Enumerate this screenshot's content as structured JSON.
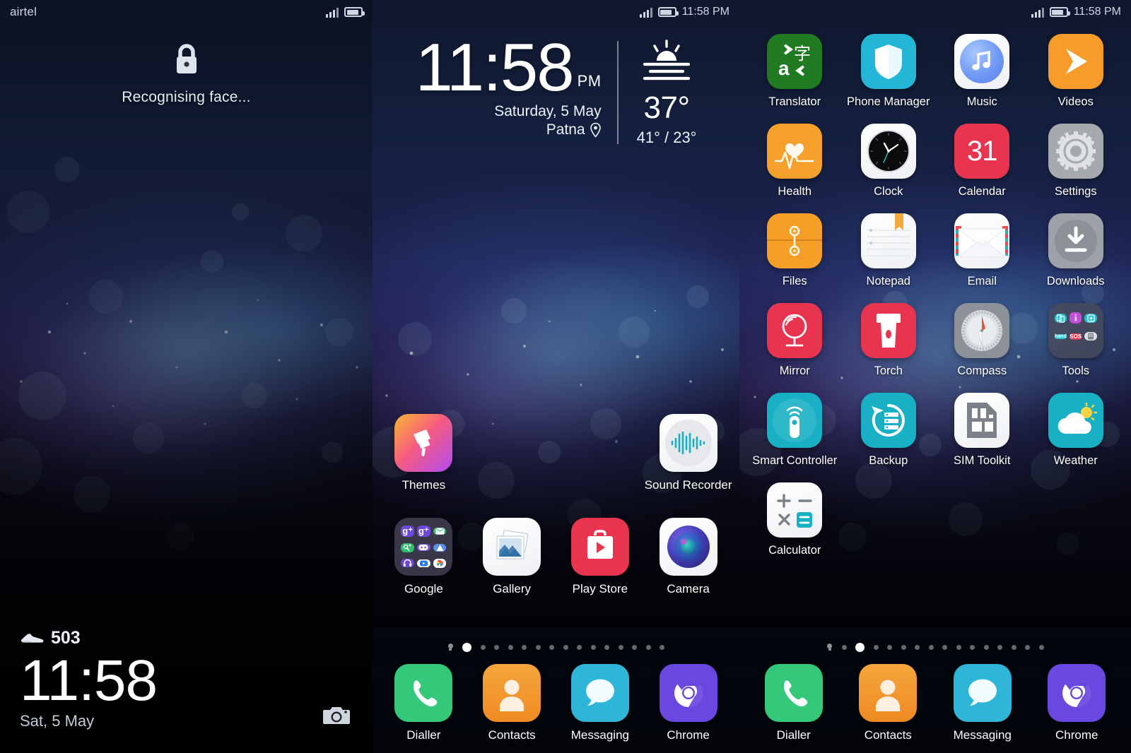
{
  "screens": [
    {
      "id": "lock-screen",
      "statusbar": {
        "carrier": "airtel",
        "time": "",
        "signal_icon": "signal-bars-icon",
        "battery_icon": "battery-icon"
      },
      "lock": {
        "lock_icon": "lock-icon",
        "message": "Recognising face...",
        "steps_icon": "shoe-icon",
        "steps": "503",
        "time": "11:58",
        "date": "Sat, 5 May",
        "shutter_icon": "camera-shutter-icon"
      }
    },
    {
      "id": "home-screen",
      "statusbar": {
        "carrier": "",
        "time": "11:58 PM",
        "signal_icon": "signal-bars-icon",
        "battery_icon": "battery-icon"
      },
      "widget": {
        "time": "11:58",
        "ampm": "PM",
        "date": "Saturday, 5 May",
        "location": "Patna",
        "location_icon": "location-pin-icon",
        "weather_icon": "haze-sun-icon",
        "temp": "37°",
        "range": "41° / 23°"
      },
      "apps": [
        {
          "label": "Themes",
          "icon": "themes-icon"
        },
        {
          "label": "",
          "icon": ""
        },
        {
          "label": "",
          "icon": ""
        },
        {
          "label": "Sound Recorder",
          "icon": "sound-recorder-icon"
        },
        {
          "label": "Google",
          "icon": "google-folder-icon"
        },
        {
          "label": "Gallery",
          "icon": "gallery-icon"
        },
        {
          "label": "Play Store",
          "icon": "play-store-icon"
        },
        {
          "label": "Camera",
          "icon": "camera-icon"
        }
      ],
      "page_dots": {
        "total": 16,
        "active_index": 1,
        "home_index": 0
      },
      "dock": [
        {
          "label": "Dialler",
          "icon": "phone-icon"
        },
        {
          "label": "Contacts",
          "icon": "contacts-icon"
        },
        {
          "label": "Messaging",
          "icon": "messaging-icon"
        },
        {
          "label": "Chrome",
          "icon": "chrome-icon"
        }
      ]
    },
    {
      "id": "app-drawer-screen",
      "statusbar": {
        "carrier": "",
        "time": "11:58 PM",
        "signal_icon": "signal-bars-icon",
        "battery_icon": "battery-icon"
      },
      "apps": [
        {
          "label": "Translator",
          "icon": "translator-icon"
        },
        {
          "label": "Phone Manager",
          "icon": "phone-manager-icon"
        },
        {
          "label": "Music",
          "icon": "music-icon"
        },
        {
          "label": "Videos",
          "icon": "videos-icon"
        },
        {
          "label": "Health",
          "icon": "health-icon"
        },
        {
          "label": "Clock",
          "icon": "clock-icon"
        },
        {
          "label": "Calendar",
          "icon": "calendar-icon"
        },
        {
          "label": "Settings",
          "icon": "settings-gear-icon"
        },
        {
          "label": "Files",
          "icon": "files-icon"
        },
        {
          "label": "Notepad",
          "icon": "notepad-icon"
        },
        {
          "label": "Email",
          "icon": "email-icon"
        },
        {
          "label": "Downloads",
          "icon": "downloads-icon"
        },
        {
          "label": "Mirror",
          "icon": "mirror-icon"
        },
        {
          "label": "Torch",
          "icon": "torch-icon"
        },
        {
          "label": "Compass",
          "icon": "compass-icon"
        },
        {
          "label": "Tools",
          "icon": "tools-folder-icon"
        },
        {
          "label": "Smart Controller",
          "icon": "smart-controller-icon"
        },
        {
          "label": "Backup",
          "icon": "backup-icon"
        },
        {
          "label": "SIM Toolkit",
          "icon": "sim-toolkit-icon"
        },
        {
          "label": "Weather",
          "icon": "weather-icon"
        },
        {
          "label": "Calculator",
          "icon": "calculator-icon"
        },
        {
          "label": "",
          "icon": ""
        },
        {
          "label": "",
          "icon": ""
        },
        {
          "label": "",
          "icon": ""
        }
      ],
      "calendar_day": "31",
      "page_dots": {
        "total": 16,
        "active_index": 2,
        "home_index": 0
      },
      "dock": [
        {
          "label": "Dialler",
          "icon": "phone-icon"
        },
        {
          "label": "Contacts",
          "icon": "contacts-icon"
        },
        {
          "label": "Messaging",
          "icon": "messaging-icon"
        },
        {
          "label": "Chrome",
          "icon": "chrome-icon"
        }
      ]
    }
  ],
  "colors": {
    "translator_green": "#1f7a21",
    "phone_manager_cyan": "#23b6d6",
    "videos_orange": "#f79c2b",
    "health_orange": "#f5a02b",
    "calendar_red": "#e8344e",
    "settings_grey": "#a6a9ae",
    "files_orange": "#f59f29",
    "downloads_grey": "#9ea2a8",
    "mirror_red": "#e8344e",
    "torch_red": "#e8344e",
    "compass_grey": "#8d9298",
    "teal": "#17b0c4",
    "dialler_green": "#34c87a",
    "contacts_orange": "#f0922e",
    "messaging_blue": "#2eb5d8",
    "chrome_purple": "#6a47e0",
    "playstore_red": "#e8344e"
  }
}
